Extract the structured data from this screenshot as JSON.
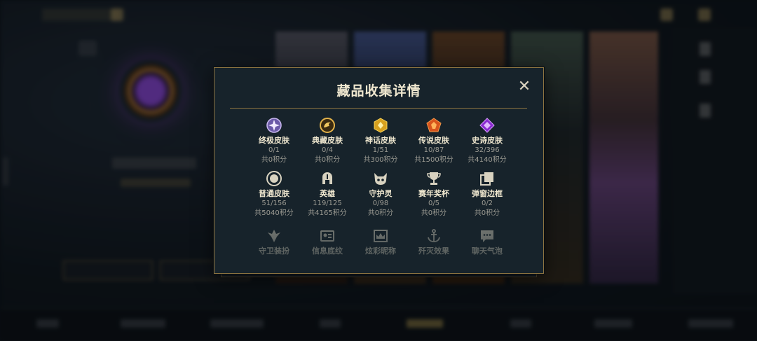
{
  "modal": {
    "title": "藏品收集详情",
    "close_glyph": "✕",
    "categories": [
      {
        "name": "终极皮肤",
        "progress": "0/1",
        "points": "共0积分",
        "icon": "ultimate-skin-icon"
      },
      {
        "name": "典藏皮肤",
        "progress": "0/4",
        "points": "共0积分",
        "icon": "prestige-skin-icon"
      },
      {
        "name": "神话皮肤",
        "progress": "1/51",
        "points": "共300积分",
        "icon": "mythic-skin-icon"
      },
      {
        "name": "传说皮肤",
        "progress": "10/87",
        "points": "共1500积分",
        "icon": "legendary-skin-icon"
      },
      {
        "name": "史诗皮肤",
        "progress": "32/396",
        "points": "共4140积分",
        "icon": "epic-skin-icon"
      },
      {
        "name": "普通皮肤",
        "progress": "51/156",
        "points": "共5040积分",
        "icon": "normal-skin-icon"
      },
      {
        "name": "英雄",
        "progress": "119/125",
        "points": "共4165积分",
        "icon": "champion-helmet-icon"
      },
      {
        "name": "守护灵",
        "progress": "0/98",
        "points": "共0积分",
        "icon": "guardian-icon"
      },
      {
        "name": "赛年奖杯",
        "progress": "0/5",
        "points": "共0积分",
        "icon": "trophy-icon"
      },
      {
        "name": "弹窗边框",
        "progress": "0/2",
        "points": "共0积分",
        "icon": "popup-frame-icon"
      },
      {
        "name": "守卫装扮",
        "icon": "ward-skin-icon"
      },
      {
        "name": "信息底纹",
        "icon": "info-card-icon"
      },
      {
        "name": "炫彩昵称",
        "icon": "crown-nameplate-icon"
      },
      {
        "name": "歼灭效果",
        "icon": "anchor-icon"
      },
      {
        "name": "聊天气泡",
        "icon": "chat-bubble-icon"
      }
    ]
  },
  "colors": {
    "modal_bg": "#17232b",
    "gold_border": "#8d7441",
    "title": "#efe7cf",
    "secondary_text": "#9b9a92"
  }
}
